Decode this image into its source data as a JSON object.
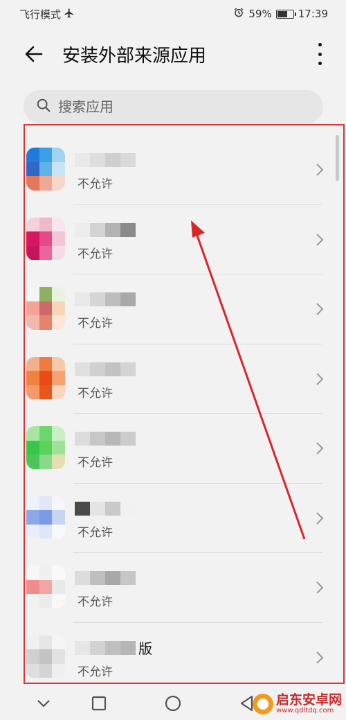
{
  "status_bar": {
    "left_text": "飞行模式",
    "battery_percent": "59%",
    "battery_level": 0.59,
    "time": "17:39"
  },
  "app_bar": {
    "title": "安装外部来源应用"
  },
  "search": {
    "placeholder": "搜索应用"
  },
  "apps": [
    {
      "name_tail": "",
      "status": "不允许",
      "icon_colors": [
        "#1f7ad8",
        "#3aa0e6",
        "#9fd3ef",
        "#2f68c7",
        "#5db2e8",
        "#c7e4f2",
        "#e07a5b",
        "#f0a895",
        "#f7d6cc"
      ],
      "name_colors": [
        "#e9e9e9",
        "#dedede",
        "#cfcfcf",
        "#d9d9d9"
      ]
    },
    {
      "name_tail": "",
      "status": "不允许",
      "icon_colors": [
        "#f4d0dc",
        "#f1b8c9",
        "#f7e6ec",
        "#d5185f",
        "#e4498a",
        "#f2c5d8",
        "#c7145a",
        "#e8669b",
        "#f7dce8"
      ],
      "name_colors": [
        "#ededed",
        "#d4d4d4",
        "#b3b3b3",
        "#8a8a8a"
      ]
    },
    {
      "name_tail": "",
      "status": "不允许",
      "icon_colors": [
        "#f5f5f5",
        "#8fb05f",
        "#e9f2dc",
        "#f2a39a",
        "#cc6a6a",
        "#f6d6b6",
        "#f1b9ae",
        "#e6836b",
        "#fbe6d8"
      ],
      "name_colors": [
        "#e8e8e8",
        "#d6d6d6",
        "#bdbdbd",
        "#a9a9a9"
      ]
    },
    {
      "name_tail": "",
      "status": "不允许",
      "icon_colors": [
        "#f3b08c",
        "#f07b3f",
        "#f8c9a8",
        "#f08240",
        "#e94a18",
        "#f5a273",
        "#f29a6a",
        "#e6561d",
        "#fbd6bf"
      ],
      "name_colors": [
        "#e0e0e0",
        "#d0d0d0",
        "#c2c2c2",
        "#d4d4d4"
      ]
    },
    {
      "name_tail": "",
      "status": "不允许",
      "icon_colors": [
        "#a7e6a0",
        "#6bd66b",
        "#c9f0c4",
        "#3ac64a",
        "#5ad25c",
        "#9ee29a",
        "#4bc558",
        "#8bd98a",
        "#e4dfb1"
      ],
      "name_colors": [
        "#dcdcdc",
        "#c7c7c7",
        "#b8b8b8",
        "#cccccc"
      ]
    },
    {
      "name_tail": "",
      "status": "不允许",
      "icon_colors": [
        "#eef2fb",
        "#dfe7f8",
        "#f4f6fc",
        "#8aa9e6",
        "#7a9ce2",
        "#c7d5f3",
        "#eaeefa",
        "#dfe6f7",
        "#f7f9fd"
      ],
      "name_colors": [
        "#4a4a4a",
        "#e4e4e4",
        "#c9c9c9",
        "#f1f1f1"
      ]
    },
    {
      "name_tail": "",
      "status": "不允许",
      "icon_colors": [
        "#f7f7f7",
        "#f0f0f0",
        "#f9f9f9",
        "#ef8c8c",
        "#f2a5a5",
        "#e9e9e9",
        "#f1f1f1",
        "#ececec",
        "#f8f8f8"
      ],
      "name_colors": [
        "#dcdcdc",
        "#bfbfbf",
        "#a8a8a8",
        "#c6c6c6"
      ]
    },
    {
      "name_tail": "版",
      "status": "不允许",
      "icon_colors": [
        "#f0f0f0",
        "#e6e6e6",
        "#f5f5f5",
        "#d0d0d0",
        "#c4c4c4",
        "#e2e2e2",
        "#dedede",
        "#d4d4d4",
        "#efefef"
      ],
      "name_colors": [
        "#e6e6e6",
        "#d3d3d3",
        "#c0c0c0",
        "#b5b5b5"
      ]
    }
  ],
  "watermark": {
    "name": "启东安卓网",
    "url": "www.qdltdq.com"
  }
}
